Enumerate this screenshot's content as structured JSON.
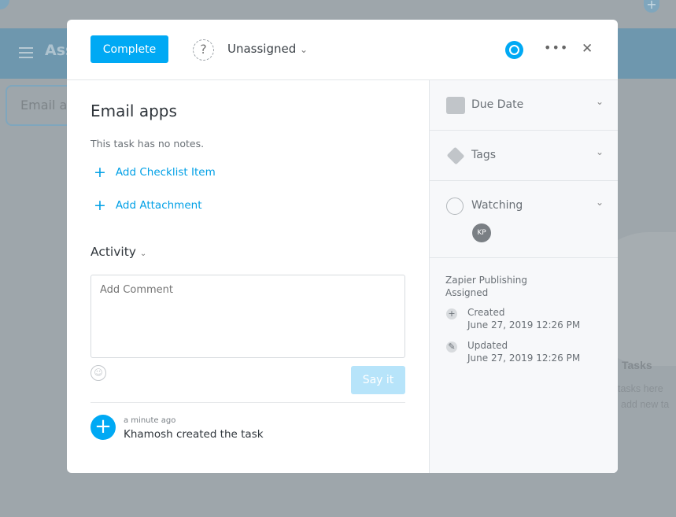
{
  "background": {
    "title": "Ass",
    "search_value": "Email ap",
    "empty_title": "Tasks",
    "empty_line1": "tasks here",
    "empty_line2": "add new ta"
  },
  "header": {
    "complete_label": "Complete",
    "assignee": "Unassigned",
    "assignee_chevron": "⌄",
    "more": "•••",
    "close": "✕"
  },
  "task": {
    "title": "Email apps",
    "notes": "This task has no notes.",
    "add_checklist": "Add Checklist Item",
    "add_attachment": "Add Attachment"
  },
  "activity": {
    "label": "Activity",
    "comment_placeholder": "Add Comment",
    "say_it": "Say it",
    "entries": [
      {
        "time": "a minute ago",
        "text": "Khamosh created the task"
      }
    ]
  },
  "sidebar": {
    "sections": [
      {
        "label": "Due Date",
        "icon": "calendar-icon"
      },
      {
        "label": "Tags",
        "icon": "tag-icon"
      },
      {
        "label": "Watching",
        "icon": "eye-icon"
      }
    ],
    "watcher_initials": "KP",
    "project": "Zapier Publishing",
    "assigned": "Assigned",
    "created_label": "Created",
    "created_at": "June 27, 2019 12:26 PM",
    "updated_label": "Updated",
    "updated_at": "June 27, 2019 12:26 PM"
  },
  "colors": {
    "accent": "#00a9f4"
  }
}
